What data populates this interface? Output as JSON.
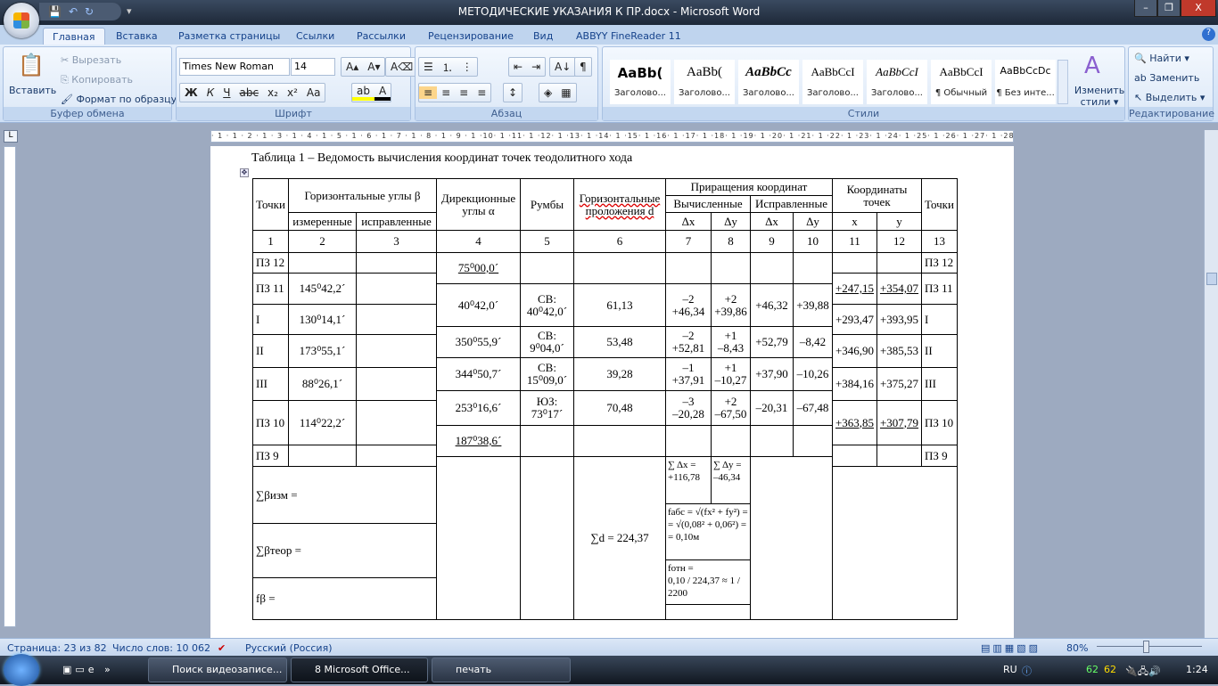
{
  "window": {
    "title": "МЕТОДИЧЕСКИЕ УКАЗАНИЯ К ПР.docx - Microsoft Word",
    "minimize": "–",
    "maximize": "❐",
    "close": "X"
  },
  "qat": {
    "save": "💾",
    "undo": "↶",
    "redo": "↻",
    "customize": "▾"
  },
  "tabs": [
    "Главная",
    "Вставка",
    "Разметка страницы",
    "Ссылки",
    "Рассылки",
    "Рецензирование",
    "Вид",
    "ABBYY FineReader 11"
  ],
  "help": "?",
  "clipboard": {
    "paste": "Вставить",
    "cut": "Вырезать",
    "copy": "Копировать",
    "format_painter": "Формат по образцу",
    "label": "Буфер обмена"
  },
  "font": {
    "name": "Times New Roman",
    "size": "14",
    "grow": "A▴",
    "shrink": "A▾",
    "clear": "A⌫",
    "bold": "Ж",
    "italic": "К",
    "underline": "Ч",
    "strike": "abc",
    "sub": "x₂",
    "sup": "x²",
    "case": "Aa",
    "highlight": "ab",
    "color": "A",
    "label": "Шрифт"
  },
  "paragraph": {
    "bullets": "☰",
    "numbering": "⒈",
    "multilevel": "⋮",
    "decrease": "⇤",
    "increase": "⇥",
    "sort": "A↓",
    "pilcrow": "¶",
    "left": "≡",
    "center": "≡",
    "right": "≡",
    "justify": "≡",
    "spacing": "↕",
    "shading": "◈",
    "borders": "▦",
    "label": "Абзац"
  },
  "styles": {
    "items": [
      {
        "sample": "AaBb(",
        "name": "Заголово..."
      },
      {
        "sample": "AaBb(",
        "name": "Заголово..."
      },
      {
        "sample": "AaBbCc",
        "name": "Заголово..."
      },
      {
        "sample": "AaBbCcI",
        "name": "Заголово..."
      },
      {
        "sample": "AaBbCcI",
        "name": "Заголово..."
      },
      {
        "sample": "AaBbCcI",
        "name": "¶ Обычный"
      },
      {
        "sample": "AaBbCcDc",
        "name": "¶ Без инте..."
      }
    ],
    "change": "Изменить стили ▾",
    "label": "Стили"
  },
  "editing": {
    "find": "Найти ▾",
    "replace": "Заменить",
    "select": "Выделить ▾",
    "label": "Редактирование"
  },
  "ruler": "· 1 · 1 · 2 · 1 · 3 · 1 · 4 · 1 · 5 · 1 · 6 · 1 · 7 · 1 · 8 · 1 · 9 · 1 ·10· 1 ·11· 1 ·12· 1 ·13· 1 ·14· 1 ·15· 1 ·16· 1 ·17· 1 ·18· 1 ·19· 1 ·20· 1 ·21· 1 ·22· 1 ·23· 1 ·24· 1 ·25· 1 ·26· 1 ·27· 1 ·28",
  "document": {
    "caption": "Таблица 1 – Ведомость вычисления координат точек теодолитного хода",
    "header": {
      "points": "Точки",
      "horiz_angles": "Горизонтальные углы β",
      "measured": "измеренные",
      "corrected": "исправленные",
      "dir_angles": "Дирекционные углы α",
      "rhumbs": "Румбы",
      "distances": "Горизонтальные проложения d",
      "increments": "Приращения координат",
      "computed": "Вычисленные",
      "corrected_inc": "Исправленные",
      "dx": "Δx",
      "dy": "Δy",
      "coords": "Координаты точек",
      "x": "x",
      "y": "y",
      "points2": "Точки"
    },
    "col_numbers": [
      "1",
      "2",
      "3",
      "4",
      "5",
      "6",
      "7",
      "8",
      "9",
      "10",
      "11",
      "12",
      "13"
    ],
    "stations": [
      {
        "point": "ПЗ 12",
        "measured": "",
        "corrected": "",
        "x": "",
        "y": "",
        "point2": "ПЗ 12"
      },
      {
        "point": "ПЗ 11",
        "measured": "145⁰42,2ˊ",
        "corrected": "",
        "x": "+247,15",
        "y": "+354,07",
        "point2": "ПЗ 11"
      },
      {
        "point": "I",
        "measured": "130⁰14,1ˊ",
        "corrected": "",
        "x": "+293,47",
        "y": "+393,95",
        "point2": "I"
      },
      {
        "point": "II",
        "measured": "173⁰55,1ˊ",
        "corrected": "",
        "x": "+346,90",
        "y": "+385,53",
        "point2": "II"
      },
      {
        "point": "III",
        "measured": "88⁰26,1ˊ",
        "corrected": "",
        "x": "+384,16",
        "y": "+375,27",
        "point2": "III"
      },
      {
        "point": "ПЗ 10",
        "measured": "114⁰22,2ˊ",
        "corrected": "",
        "x": "+363,85",
        "y": "+307,79",
        "point2": "ПЗ 10"
      },
      {
        "point": "ПЗ 9",
        "measured": "",
        "corrected": "",
        "x": "",
        "y": "",
        "point2": "ПЗ 9"
      }
    ],
    "lines": [
      {
        "alpha": "75⁰00,0ˊ",
        "rhumb": "",
        "d": "",
        "dx": "",
        "dy": "",
        "dx_c": "",
        "dy_c": ""
      },
      {
        "alpha": "40⁰42,0ˊ",
        "rhumb": "СВ:\n40⁰42,0ˊ",
        "d": "61,13",
        "dx": "–2\n+46,34",
        "dy": "+2\n+39,86",
        "dx_c": "+46,32",
        "dy_c": "+39,88"
      },
      {
        "alpha": "350⁰55,9ˊ",
        "rhumb": "СВ:\n9⁰04,0ˊ",
        "d": "53,48",
        "dx": "–2\n+52,81",
        "dy": "+1\n–8,43",
        "dx_c": "+52,79",
        "dy_c": "–8,42"
      },
      {
        "alpha": "344⁰50,7ˊ",
        "rhumb": "СВ:\n15⁰09,0ˊ",
        "d": "39,28",
        "dx": "–1\n+37,91",
        "dy": "+1\n–10,27",
        "dx_c": "+37,90",
        "dy_c": "–10,26"
      },
      {
        "alpha": "253⁰16,6ˊ",
        "rhumb": "ЮЗ:\n73⁰17ˊ",
        "d": "70,48",
        "dx": "–3\n–20,28",
        "dy": "+2\n–67,50",
        "dx_c": "–20,31",
        "dy_c": "–67,48"
      },
      {
        "alpha": "187⁰38,6ˊ",
        "rhumb": "",
        "d": "",
        "dx": "",
        "dy": "",
        "dx_c": "",
        "dy_c": ""
      }
    ],
    "summary": {
      "sum_beta_meas": "∑βизм =",
      "sum_beta_theor": "∑βтеор =",
      "f_beta": "fβ =",
      "sum_d": "∑d =  224,37",
      "sum_dx": "∑ Δx =\n+116,78",
      "sum_dy": "∑ Δy =\n–46,34",
      "f_abs": "fабс = √(fx² + fy²) =\n= √(0,08² + 0,06²) =\n= 0,10м",
      "f_rel": "fотн =\n0,10 / 224,37 ≈ 1 / 2200"
    }
  },
  "status": {
    "page": "Страница: 23 из 82",
    "words": "Число слов: 10 062",
    "language": "Русский (Россия)",
    "zoom": "80%"
  },
  "taskbar": {
    "items": [
      "Поиск видеозаписе...",
      "8 Microsoft Office...",
      "печать"
    ],
    "lang": "RU",
    "time": "1:24",
    "tray_a": "62",
    "tray_b": "62"
  }
}
